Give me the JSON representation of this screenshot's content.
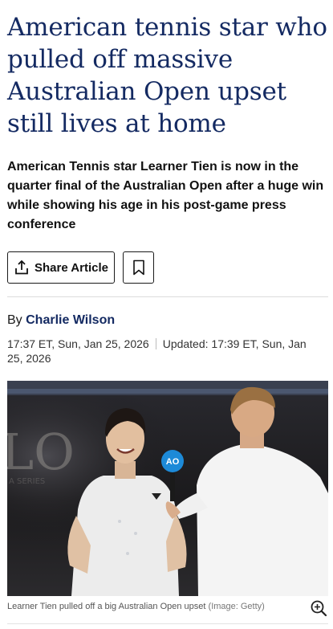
{
  "article": {
    "headline": "American tennis star who pulled off massive Australian Open upset still lives at home",
    "standfirst": "American Tennis star Learner Tien is now in the quarter final of the Australian Open after a huge win while showing his age in his post-game press conference",
    "share_label": "Share Article",
    "byline_prefix": "By",
    "author": "Charlie Wilson",
    "published": "17:37 ET, Sun, Jan 25, 2026",
    "updated": "Updated: 17:39 ET, Sun, Jan 25, 2026",
    "image": {
      "caption": "Learner Tien pulled off a big Australian Open upset",
      "credit": "(Image: Getty)",
      "badge_text": "AO"
    }
  },
  "icons": {
    "share": "share-icon",
    "bookmark": "bookmark-icon",
    "zoom": "zoom-in-icon"
  },
  "colors": {
    "headline": "#142a62",
    "author": "#142a62",
    "text": "#111111"
  }
}
